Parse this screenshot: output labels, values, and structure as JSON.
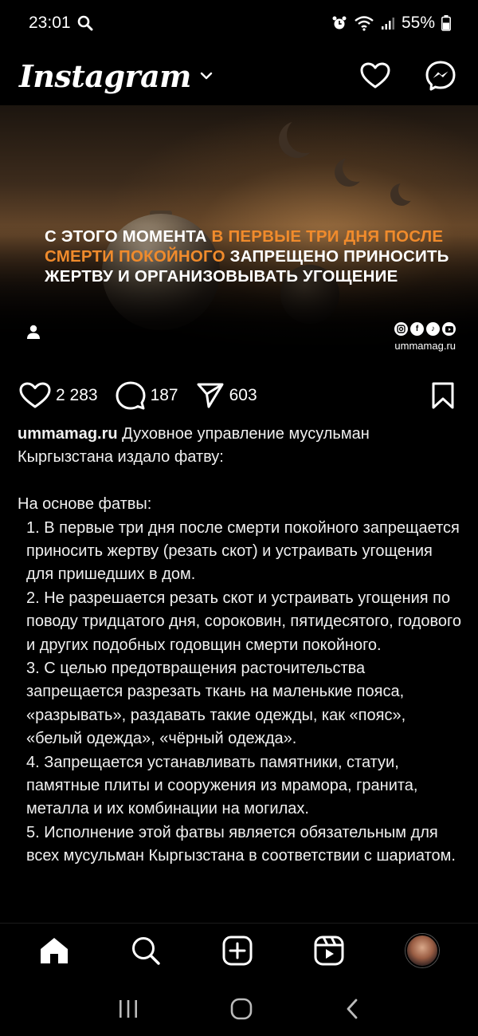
{
  "status_bar": {
    "time": "23:01",
    "battery": "55%"
  },
  "header": {
    "logo_text": "Instagram"
  },
  "post": {
    "headline_part1": "С этого момента ",
    "headline_highlight": "в первые три дня после смерти покойного",
    "headline_part2": " запрещено приносить жертву и организовывать угощение",
    "highlight_color": "#f08b2c",
    "brand_site": "ummamag.ru",
    "brand_icons": [
      "instagram-icon",
      "facebook-icon",
      "tiktok-icon",
      "youtube-icon"
    ]
  },
  "actions": {
    "likes": "2 283",
    "comments": "187",
    "shares": "603"
  },
  "caption": {
    "username": "ummamag.ru",
    "intro": " Духовное управление мусульман Кыргызстана издало фатву:",
    "basis": "На основе фатвы:",
    "items": [
      "1. В первые три дня после смерти покойного запрещается приносить жертву (резать скот) и устраивать угощения для пришедших в дом.",
      "2. Не разрешается резать скот и устраивать угощения по поводу тридцатого дня, сороковин, пятидесятого, годового и других подобных годовщин смерти покойного.",
      "3. С целью предотвращения расточительства запрещается разрезать ткань на маленькие пояса, «разрывать», раздавать такие одежды, как «пояс», «белый одежда», «чёрный одежда».",
      "4. Запрещается устанавливать памятники, статуи, памятные плиты и сооружения из мрамора, гранита, металла и их комбинации на могилах.",
      "5. Исполнение этой фатвы является обязательным для всех мусульман Кыргызстана в соответствии с шариатом."
    ]
  },
  "bottom_nav": [
    "home-icon",
    "search-icon",
    "create-icon",
    "reels-icon",
    "profile-avatar"
  ],
  "system_nav": [
    "recents-icon",
    "home-button-icon",
    "back-icon"
  ]
}
